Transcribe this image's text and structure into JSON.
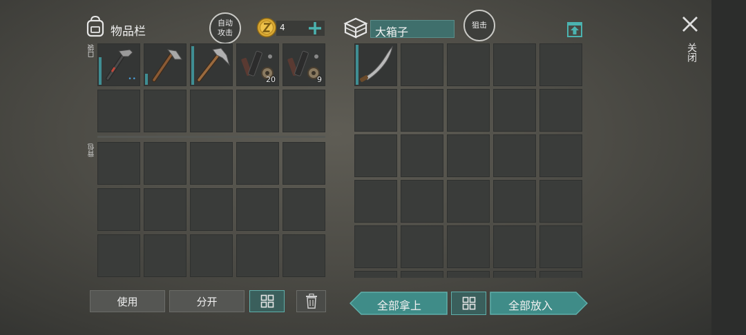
{
  "inventory": {
    "title": "物品栏",
    "auto_attack_label": "自动攻击",
    "coin_count": "4",
    "pocket_label": "口袋",
    "backpack_label": "背包",
    "pocket_items": [
      {
        "icon": "hammer-icon",
        "count": "",
        "durability": 0.5,
        "dots": "••"
      },
      {
        "icon": "hatchet-icon",
        "count": "",
        "durability": 0.3,
        "dots": ""
      },
      {
        "icon": "pickaxe-icon",
        "count": "",
        "durability": 0.9,
        "dots": ""
      },
      {
        "icon": "parts-icon",
        "count": "20",
        "durability": 0,
        "dots": ""
      },
      {
        "icon": "parts-icon",
        "count": "9",
        "durability": 0,
        "dots": ""
      }
    ]
  },
  "container": {
    "name": "大箱子",
    "snipe_label": "狙击",
    "items": [
      {
        "icon": "machete-icon",
        "count": "",
        "durability": 0.95
      }
    ]
  },
  "actions": {
    "use": "使用",
    "split": "分开",
    "take_all": "全部拿上",
    "put_all": "全部放入"
  },
  "close_label": "关闭",
  "colors": {
    "accent": "#3f8c88",
    "slot": "#3a3c3a",
    "durability": "#3f8e93"
  }
}
